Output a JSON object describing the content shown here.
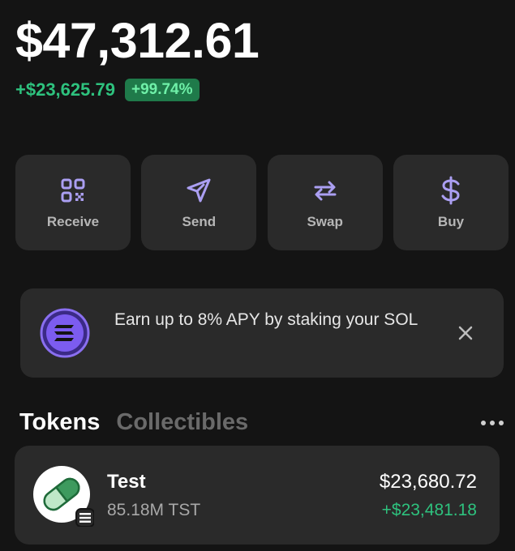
{
  "portfolio": {
    "balance": "$47,312.61",
    "change_amount": "+$23,625.79",
    "change_percent": "+99.74%"
  },
  "actions": [
    {
      "label": "Receive",
      "icon": "qr-code-icon"
    },
    {
      "label": "Send",
      "icon": "send-icon"
    },
    {
      "label": "Swap",
      "icon": "swap-icon"
    },
    {
      "label": "Buy",
      "icon": "dollar-icon"
    }
  ],
  "banner": {
    "text": "Earn up to 8% APY by staking your SOL",
    "icon": "solana-icon",
    "close_icon": "close-icon"
  },
  "tabs": [
    {
      "label": "Tokens",
      "active": true
    },
    {
      "label": "Collectibles",
      "active": false
    }
  ],
  "more_icon": "more-dots-icon",
  "tokens": [
    {
      "name": "Test",
      "quantity": "85.18M TST",
      "value": "$23,680.72",
      "change": "+$23,481.18",
      "icon": "pill-token-icon"
    }
  ],
  "colors": {
    "background": "#141414",
    "card": "#2a2a2a",
    "accent": "#ab9ff2",
    "positive": "#2ec27e",
    "badge": "#1f7a4a"
  }
}
